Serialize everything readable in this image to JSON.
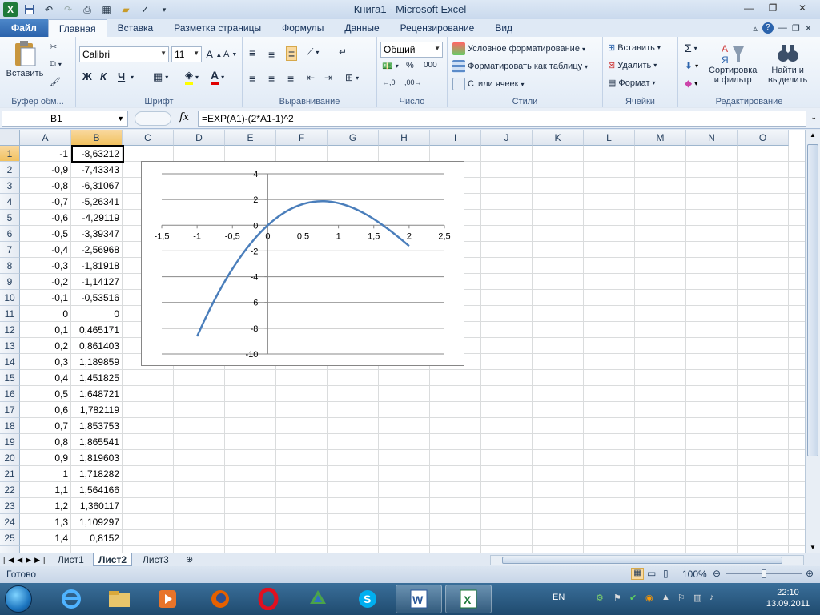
{
  "window": {
    "title": "Книга1  -  Microsoft Excel"
  },
  "tabs": [
    "Файл",
    "Главная",
    "Вставка",
    "Разметка страницы",
    "Формулы",
    "Данные",
    "Рецензирование",
    "Вид"
  ],
  "ribbon": {
    "clipboard": {
      "label": "Буфер обм...",
      "paste": "Вставить"
    },
    "font": {
      "label": "Шрифт",
      "name": "Calibri",
      "size": "11",
      "bold": "Ж",
      "italic": "К",
      "underline": "Ч"
    },
    "alignment": {
      "label": "Выравнивание"
    },
    "number": {
      "label": "Число",
      "format": "Общий",
      "percent": "%",
      "thousands": "000"
    },
    "styles": {
      "label": "Стили",
      "conditional": "Условное форматирование",
      "as_table": "Форматировать как таблицу",
      "cell_styles": "Стили ячеек"
    },
    "cells": {
      "label": "Ячейки",
      "insert": "Вставить",
      "delete": "Удалить",
      "format": "Формат"
    },
    "editing": {
      "label": "Редактирование",
      "sort_l1": "Сортировка",
      "sort_l2": "и фильтр",
      "find_l1": "Найти и",
      "find_l2": "выделить"
    }
  },
  "formula_bar": {
    "name_box": "B1",
    "fx": "fx",
    "formula": "=EXP(A1)-(2*A1-1)^2"
  },
  "columns": [
    "A",
    "B",
    "C",
    "D",
    "E",
    "F",
    "G",
    "H",
    "I",
    "J",
    "K",
    "L",
    "M",
    "N",
    "O"
  ],
  "rows": [
    {
      "n": "1",
      "a": "-1",
      "b": "-8,63212"
    },
    {
      "n": "2",
      "a": "-0,9",
      "b": "-7,43343"
    },
    {
      "n": "3",
      "a": "-0,8",
      "b": "-6,31067"
    },
    {
      "n": "4",
      "a": "-0,7",
      "b": "-5,26341"
    },
    {
      "n": "5",
      "a": "-0,6",
      "b": "-4,29119"
    },
    {
      "n": "6",
      "a": "-0,5",
      "b": "-3,39347"
    },
    {
      "n": "7",
      "a": "-0,4",
      "b": "-2,56968"
    },
    {
      "n": "8",
      "a": "-0,3",
      "b": "-1,81918"
    },
    {
      "n": "9",
      "a": "-0,2",
      "b": "-1,14127"
    },
    {
      "n": "10",
      "a": "-0,1",
      "b": "-0,53516"
    },
    {
      "n": "11",
      "a": "0",
      "b": "0"
    },
    {
      "n": "12",
      "a": "0,1",
      "b": "0,465171"
    },
    {
      "n": "13",
      "a": "0,2",
      "b": "0,861403"
    },
    {
      "n": "14",
      "a": "0,3",
      "b": "1,189859"
    },
    {
      "n": "15",
      "a": "0,4",
      "b": "1,451825"
    },
    {
      "n": "16",
      "a": "0,5",
      "b": "1,648721"
    },
    {
      "n": "17",
      "a": "0,6",
      "b": "1,782119"
    },
    {
      "n": "18",
      "a": "0,7",
      "b": "1,853753"
    },
    {
      "n": "19",
      "a": "0,8",
      "b": "1,865541"
    },
    {
      "n": "20",
      "a": "0,9",
      "b": "1,819603"
    },
    {
      "n": "21",
      "a": "1",
      "b": "1,718282"
    },
    {
      "n": "22",
      "a": "1,1",
      "b": "1,564166"
    },
    {
      "n": "23",
      "a": "1,2",
      "b": "1,360117"
    },
    {
      "n": "24",
      "a": "1,3",
      "b": "1,109297"
    },
    {
      "n": "25",
      "a": "1,4",
      "b": "0,8152"
    }
  ],
  "chart_data": {
    "type": "scatter",
    "title": "",
    "xlabel": "",
    "ylabel": "",
    "xlim": [
      -1.5,
      2.5
    ],
    "ylim": [
      -10,
      4
    ],
    "x_ticks": [
      "-1,5",
      "-1",
      "-0,5",
      "0",
      "0,5",
      "1",
      "1,5",
      "2",
      "2,5"
    ],
    "y_ticks": [
      "4",
      "2",
      "0",
      "-2",
      "-4",
      "-6",
      "-8",
      "-10"
    ],
    "grid": true,
    "series": [
      {
        "color": "#4a7ebb",
        "smooth": true,
        "x": [
          -1,
          -0.9,
          -0.8,
          -0.7,
          -0.6,
          -0.5,
          -0.4,
          -0.3,
          -0.2,
          -0.1,
          0,
          0.1,
          0.2,
          0.3,
          0.4,
          0.5,
          0.6,
          0.7,
          0.8,
          0.9,
          1,
          1.1,
          1.2,
          1.3,
          1.4,
          1.5,
          1.6,
          1.7,
          1.8,
          1.9,
          2
        ],
        "y": [
          -8.63212,
          -7.43343,
          -6.31067,
          -5.26341,
          -4.29119,
          -3.39347,
          -2.56968,
          -1.81918,
          -1.14127,
          -0.53516,
          0,
          0.465171,
          0.861403,
          1.189859,
          1.451825,
          1.648721,
          1.782119,
          1.853753,
          1.865541,
          1.819603,
          1.718282,
          1.564166,
          1.360117,
          1.109297,
          0.8152,
          0.481689,
          0.113032,
          -0.286053,
          -0.710353,
          -1.154194,
          -1.610944
        ]
      }
    ]
  },
  "sheets": [
    "Лист1",
    "Лист2",
    "Лист3"
  ],
  "status": {
    "ready": "Готово",
    "zoom": "100%"
  },
  "tray": {
    "lang": "EN",
    "time": "22:10",
    "date": "13.09.2011"
  }
}
